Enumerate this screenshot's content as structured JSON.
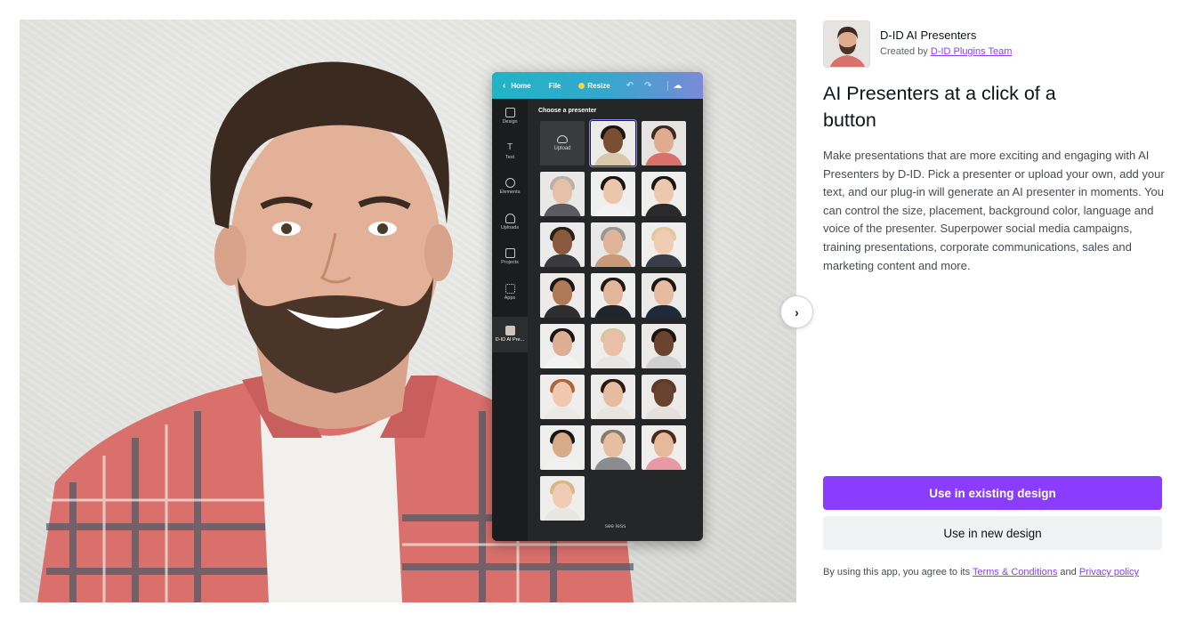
{
  "mock": {
    "top": {
      "home": "Home",
      "file": "File",
      "resize": "Resize"
    },
    "side": [
      "Design",
      "Text",
      "Elements",
      "Uploads",
      "Projects",
      "Apps",
      "D-ID AI Pre..."
    ],
    "choose": "Choose a presenter",
    "upload": "Upload",
    "see_less": "see less"
  },
  "app": {
    "name": "D-ID AI Presenters",
    "created_prefix": "Created by ",
    "creator": "D-ID Plugins Team"
  },
  "heading": "AI Presenters at a click of a button",
  "description": "Make presentations that are more exciting and engaging with AI Presenters by D-ID. Pick a presenter or upload your own, add your text, and our plug-in will generate an AI presenter in moments. You can control the size, placement, background color, language and voice of the presenter. Superpower social media campaigns, training presentations, corporate communications, sales and marketing content and more.",
  "buttons": {
    "existing": "Use in existing design",
    "new": "Use in new design"
  },
  "agreement": {
    "prefix": "By using this app, you agree to its ",
    "terms": "Terms & Conditions",
    "and": " and ",
    "privacy": "Privacy policy"
  },
  "colors": {
    "accent": "#8b3dff",
    "mock_header_start": "#1fb5c7",
    "mock_header_end": "#7a8ad8"
  },
  "icons": [
    "chevron-left-icon",
    "undo-icon",
    "redo-icon",
    "cloud-icon",
    "upload-icon",
    "chevron-right-icon"
  ]
}
